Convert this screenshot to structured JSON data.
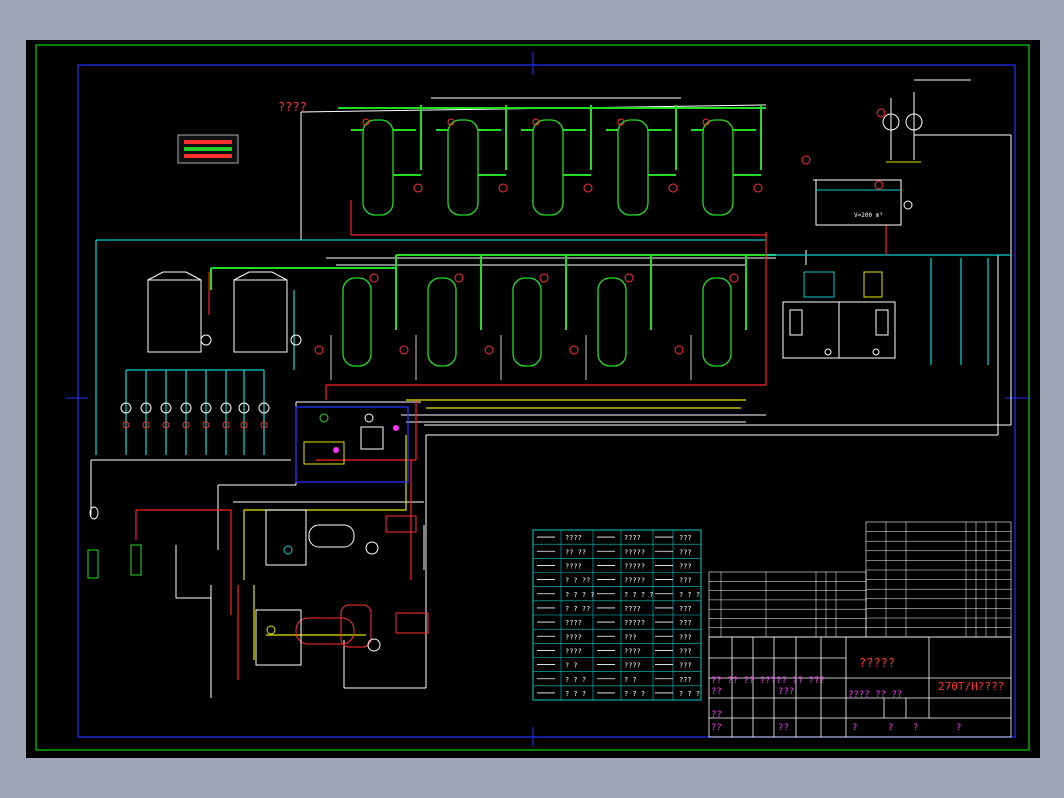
{
  "drawing": {
    "top_left_note": "????",
    "title_block": {
      "center_title": "?????",
      "project_title": "270T/H????",
      "row1": "?? ?? ?? ????? ?? ???",
      "row2": "??",
      "row2b": "???",
      "row3": "???? ?? ??",
      "row4": "??",
      "row5": "??",
      "row5b": "??",
      "row6": [
        "?",
        "?",
        "?",
        "?"
      ]
    },
    "tank_label": "V=200 m³",
    "legend": {
      "rows": [
        [
          "????",
          "????",
          "???"
        ],
        [
          "?? ??",
          "?????",
          "???"
        ],
        [
          "????",
          "?????",
          "???"
        ],
        [
          "? ? ??",
          "?????",
          "???"
        ],
        [
          "? ? ? ?",
          "? ? ? ?",
          "? ? ?"
        ],
        [
          "? ? ??",
          "????",
          "???"
        ],
        [
          "????",
          "?????",
          "???"
        ],
        [
          "????",
          "???",
          "???"
        ],
        [
          "????",
          "????",
          "???"
        ],
        [
          "? ?",
          "????",
          "???"
        ],
        [
          "? ? ?",
          "? ?",
          "???"
        ],
        [
          "? ? ?",
          "? ? ?",
          "? ? ?"
        ]
      ]
    }
  }
}
